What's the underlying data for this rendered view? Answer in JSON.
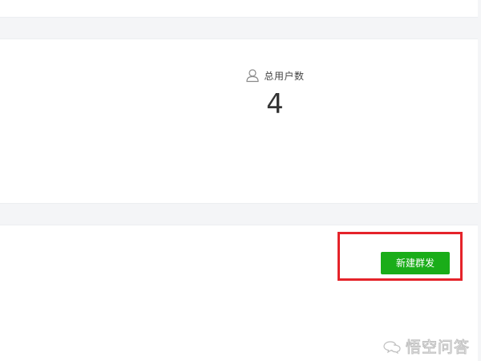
{
  "stats": {
    "icon": "user-icon",
    "total_users_label": "总用户数",
    "total_users_value": "4"
  },
  "mass_send": {
    "new_button_label": "新建群发"
  },
  "watermark": {
    "icon": "chat-bubble-icon",
    "text": "悟空问答"
  },
  "colors": {
    "button": "#1aad19",
    "highlight": "#e5232a"
  }
}
